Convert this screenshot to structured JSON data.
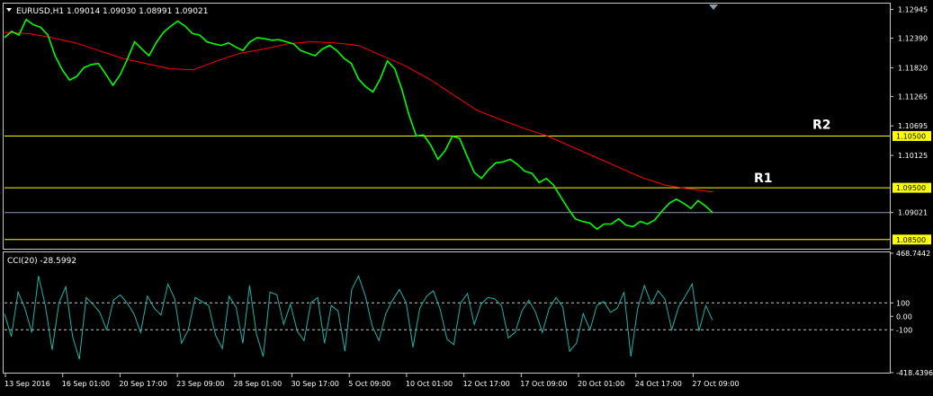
{
  "main_panel": {
    "symbol_header": "EURUSD,H1  1.09014 1.09030 1.08991 1.09021",
    "price_ticks": [
      "1.12945",
      "1.12390",
      "1.11820",
      "1.11265",
      "1.10695",
      "1.10125",
      "1.09021"
    ],
    "levels": [
      {
        "label": "1.10500",
        "value": 1.105,
        "annotation": "R2"
      },
      {
        "label": "1.09500",
        "value": 1.095,
        "annotation": "R1"
      },
      {
        "label": "1.08500",
        "value": 1.085,
        "annotation": ""
      }
    ],
    "current_price": {
      "label": "1.09021",
      "value": 1.09021
    }
  },
  "cci_panel": {
    "header": "CCI(20) -28.5992",
    "ticks": [
      "468.7442",
      "100",
      "0.00",
      "-100",
      "-418.4396"
    ]
  },
  "time_axis": [
    "13 Sep 2016",
    "16 Sep 01:00",
    "20 Sep 17:00",
    "23 Sep 09:00",
    "28 Sep 01:00",
    "30 Sep 17:00",
    "5 Oct 09:00",
    "10 Oct 01:00",
    "12 Oct 17:00",
    "17 Oct 09:00",
    "20 Oct 01:00",
    "24 Oct 17:00",
    "27 Oct 09:00"
  ],
  "colors": {
    "background": "#000000",
    "price": "#00ff00",
    "moving_average": "#ff0000",
    "level": "#ffff00",
    "current_price_line": "#8c9ab2",
    "cci": "#20b2aa",
    "text": "#ffffff"
  },
  "chart_data": [
    {
      "type": "line",
      "ylim": [
        1.0834,
        1.1304
      ],
      "grid": false,
      "series": [
        {
          "values": [
            1.124,
            1.1252,
            1.1245,
            1.1275,
            1.1265,
            1.126,
            1.1245,
            1.1205,
            1.1178,
            1.1158,
            1.1165,
            1.1182,
            1.1188,
            1.119,
            1.117,
            1.1148,
            1.1168,
            1.1198,
            1.1232,
            1.1218,
            1.1205,
            1.123,
            1.125,
            1.1262,
            1.1272,
            1.1262,
            1.1248,
            1.1245,
            1.1232,
            1.1228,
            1.1225,
            1.123,
            1.1222,
            1.1215,
            1.1232,
            1.124,
            1.1238,
            1.1235,
            1.1236,
            1.1232,
            1.1228,
            1.1215,
            1.121,
            1.1205,
            1.1218,
            1.1225,
            1.1215,
            1.12,
            1.119,
            1.116,
            1.1145,
            1.1135,
            1.116,
            1.1195,
            1.118,
            1.114,
            1.109,
            1.105,
            1.1052,
            1.1032,
            1.1005,
            1.1022,
            1.105,
            1.1045,
            1.1012,
            1.098,
            1.0968,
            1.0985,
            1.0998,
            1.1,
            1.1005,
            1.0995,
            1.0982,
            1.0978,
            1.096,
            1.0968,
            1.0955,
            1.0932,
            1.091,
            1.089,
            1.0885,
            1.0882,
            1.087,
            1.088,
            1.088,
            1.089,
            1.0878,
            1.0875,
            1.0885,
            1.088,
            1.0888,
            1.0905,
            1.092,
            1.0928,
            1.092,
            1.091,
            1.0925,
            1.0915,
            1.0902
          ]
        },
        {
          "values": [
            1.125,
            1.1248,
            1.124,
            1.123,
            1.1215,
            1.12,
            1.119,
            1.118,
            1.1178,
            1.1195,
            1.121,
            1.1218,
            1.1228,
            1.1232,
            1.123,
            1.1225,
            1.1205,
            1.1185,
            1.116,
            1.113,
            1.11,
            1.1082,
            1.1065,
            1.105,
            1.103,
            1.101,
            1.099,
            1.097,
            1.0955,
            1.0948,
            1.0942
          ]
        }
      ]
    },
    {
      "type": "line",
      "ylim": [
        -418.4396,
        468.7442
      ],
      "grid": false,
      "series": [
        {
          "values": [
            20,
            -150,
            180,
            60,
            -120,
            300,
            80,
            -250,
            100,
            220,
            -150,
            -320,
            140,
            90,
            30,
            -100,
            120,
            160,
            100,
            20,
            -120,
            150,
            60,
            10,
            240,
            130,
            -200,
            -100,
            140,
            110,
            80,
            -140,
            -240,
            150,
            70,
            -200,
            230,
            -130,
            -300,
            180,
            160,
            -60,
            90,
            -110,
            -180,
            100,
            140,
            -200,
            80,
            40,
            -260,
            200,
            300,
            150,
            -70,
            -180,
            20,
            120,
            200,
            100,
            -230,
            60,
            150,
            190,
            50,
            -170,
            -210,
            100,
            170,
            -60,
            90,
            140,
            130,
            80,
            -160,
            -120,
            40,
            120,
            30,
            -120,
            60,
            140,
            70,
            -260,
            -200,
            20,
            -100,
            80,
            110,
            30,
            60,
            180,
            -300,
            60,
            230,
            90,
            190,
            130,
            -100,
            70,
            150,
            240,
            -110,
            80,
            -29
          ]
        }
      ]
    }
  ]
}
